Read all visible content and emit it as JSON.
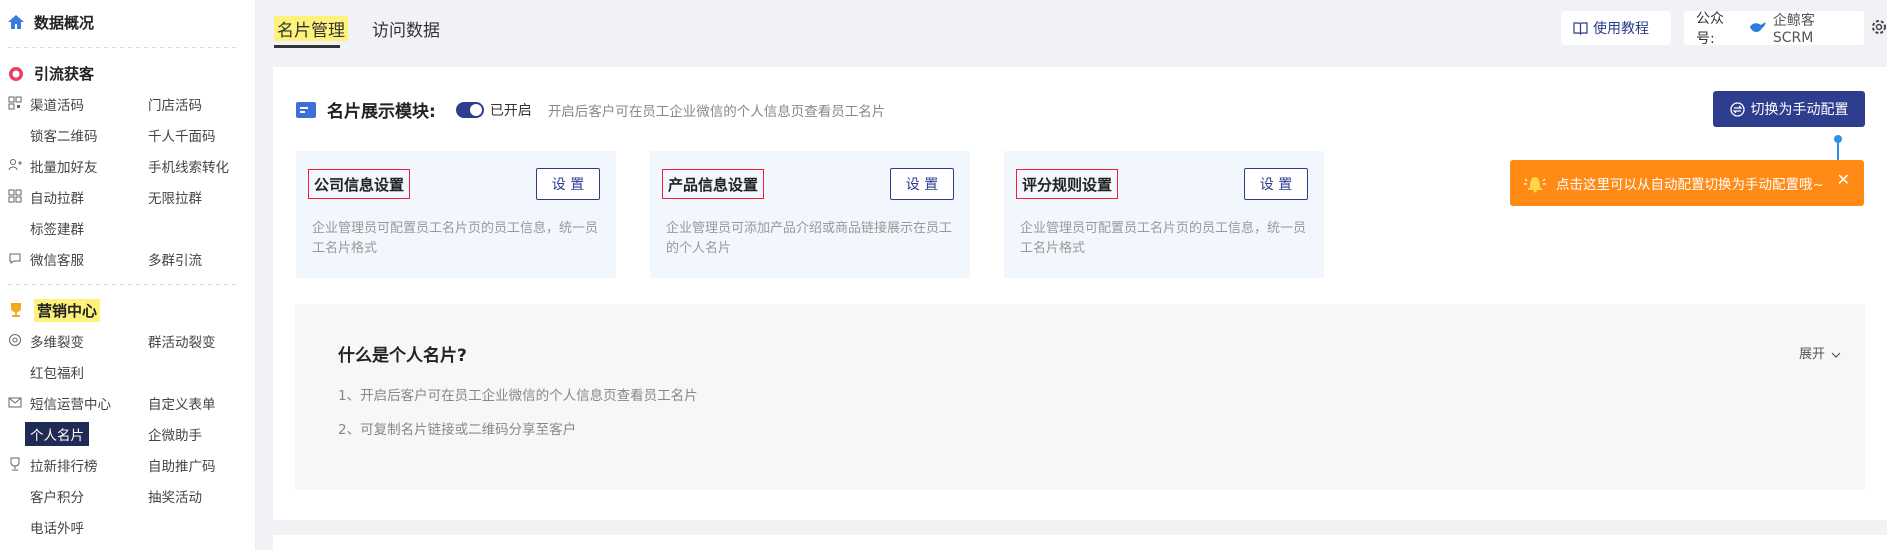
{
  "sidebar": {
    "overview": "数据概况",
    "sections": [
      {
        "title": "引流获客",
        "rows": [
          [
            "渠道活码",
            "门店活码"
          ],
          [
            "锁客二维码",
            "千人千面码"
          ],
          [
            "批量加好友",
            "手机线索转化"
          ],
          [
            "自动拉群",
            "无限拉群"
          ],
          [
            "标签建群",
            ""
          ],
          [
            "微信客服",
            "多群引流"
          ]
        ]
      },
      {
        "title": "营销中心",
        "rows": [
          [
            "多维裂变",
            "群活动裂变"
          ],
          [
            "红包福利",
            ""
          ],
          [
            "短信运营中心",
            "自定义表单"
          ],
          [
            "个人名片",
            "企微助手"
          ],
          [
            "拉新排行榜",
            "自助推广码"
          ],
          [
            "客户积分",
            "抽奖活动"
          ],
          [
            "电话外呼",
            ""
          ]
        ]
      }
    ]
  },
  "topbar": {
    "tabs": [
      "名片管理",
      "访问数据"
    ],
    "help": "使用教程",
    "gzh_label": "公众号:",
    "gzh_name": "企鲸客SCRM"
  },
  "module": {
    "title": "名片展示模块:",
    "toggle_label": "已开启",
    "desc": "开启后客户可在员工企业微信的个人信息页查看员工名片",
    "switch_btn": "切换为手动配置"
  },
  "cards": [
    {
      "title": "公司信息设置",
      "btn": "设 置",
      "desc": "企业管理员可配置员工名片页的员工信息，统一员工名片格式"
    },
    {
      "title": "产品信息设置",
      "btn": "设 置",
      "desc": "企业管理员可添加产品介绍或商品链接展示在员工的个人名片"
    },
    {
      "title": "评分规则设置",
      "btn": "设 置",
      "desc": "企业管理员可配置员工名片页的员工信息，统一员工名片格式"
    }
  ],
  "tooltip": {
    "text": "点击这里可以从自动配置切换为手动配置哦~",
    "close": "✕"
  },
  "faq": {
    "title": "什么是个人名片?",
    "expand": "展开",
    "lines": [
      "1、开启后客户可在员工企业微信的个人信息页查看员工名片",
      "2、可复制名片链接或二维码分享至客户"
    ]
  }
}
